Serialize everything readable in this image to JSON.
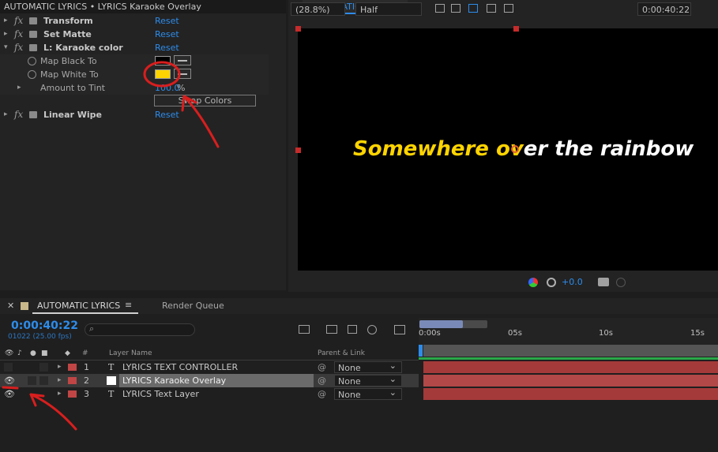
{
  "effect_controls": {
    "title": "AUTOMATIC LYRICS • LYRICS Karaoke Overlay",
    "effects": [
      {
        "name": "Transform",
        "reset": "Reset"
      },
      {
        "name": "Set Matte",
        "reset": "Reset"
      },
      {
        "name": "L: Karaoke color",
        "reset": "Reset"
      },
      {
        "name": "Linear Wipe",
        "reset": "Reset"
      }
    ],
    "properties": [
      {
        "name": "Map Black To",
        "color": "#000000"
      },
      {
        "name": "Map White To",
        "color": "#FFD400"
      },
      {
        "name": "Amount to Tint",
        "value": "100.0",
        "unit": "%"
      }
    ],
    "swap_colors_label": "Swap Colors"
  },
  "comp_viewer": {
    "tab": "AUTOMATIC LYRICS",
    "lyric_sung": "Somewhere ov",
    "lyric_rest": "er the rainbow",
    "sung_color": "#FFD400",
    "rest_color": "#FFFFFF",
    "zoom": "(28.8%)",
    "resolution": "Half",
    "exposure": "+0.0",
    "timecode": "0:00:40:22"
  },
  "timeline": {
    "tab": "AUTOMATIC LYRICS",
    "tab2": "Render Queue",
    "timecode": "0:00:40:22",
    "frame_info": "01022 (25.00 fps)",
    "col_hash": "#",
    "col_layer": "Layer Name",
    "col_parent": "Parent & Link",
    "ruler": [
      "0:00s",
      "05s",
      "10s",
      "15s"
    ],
    "layers": [
      {
        "num": "1",
        "name": "LYRICS TEXT CONTROLLER",
        "parent": "None"
      },
      {
        "num": "2",
        "name": "LYRICS Karaoke Overlay",
        "parent": "None"
      },
      {
        "num": "3",
        "name": "LYRICS Text Layer",
        "parent": "None"
      }
    ]
  },
  "annotation_color": "#D81E1E"
}
